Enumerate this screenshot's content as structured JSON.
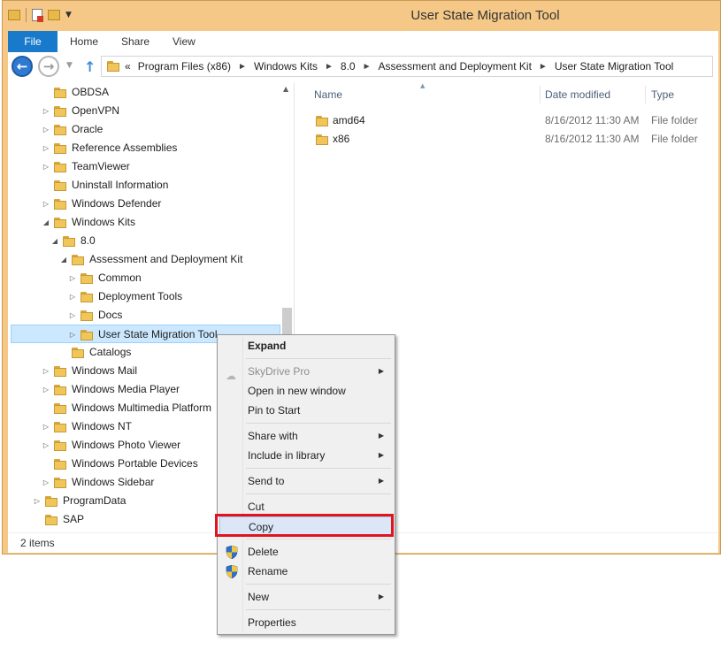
{
  "window": {
    "title": "User State Migration Tool"
  },
  "ribbon": {
    "tabs": [
      "File",
      "Home",
      "Share",
      "View"
    ]
  },
  "address": {
    "prefix": "«",
    "crumbs": [
      "Program Files (x86)",
      "Windows Kits",
      "8.0",
      "Assessment and Deployment Kit",
      "User State Migration Tool"
    ]
  },
  "nav_tree": [
    {
      "label": "OBDSA",
      "level": 2,
      "expander": ""
    },
    {
      "label": "OpenVPN",
      "level": 2,
      "expander": "▷"
    },
    {
      "label": "Oracle",
      "level": 2,
      "expander": "▷"
    },
    {
      "label": "Reference Assemblies",
      "level": 2,
      "expander": "▷"
    },
    {
      "label": "TeamViewer",
      "level": 2,
      "expander": "▷"
    },
    {
      "label": "Uninstall Information",
      "level": 2,
      "expander": ""
    },
    {
      "label": "Windows Defender",
      "level": 2,
      "expander": "▷"
    },
    {
      "label": "Windows Kits",
      "level": 2,
      "expander": "◢"
    },
    {
      "label": "8.0",
      "level": 3,
      "expander": "◢"
    },
    {
      "label": "Assessment and Deployment Kit",
      "level": 4,
      "expander": "◢"
    },
    {
      "label": "Common",
      "level": 5,
      "expander": "▷"
    },
    {
      "label": "Deployment Tools",
      "level": 5,
      "expander": "▷"
    },
    {
      "label": "Docs",
      "level": 5,
      "expander": "▷"
    },
    {
      "label": "User State Migration Tool",
      "level": 5,
      "expander": "▷",
      "selected": true
    },
    {
      "label": "Catalogs",
      "level": 4,
      "expander": ""
    },
    {
      "label": "Windows Mail",
      "level": 2,
      "expander": "▷"
    },
    {
      "label": "Windows Media Player",
      "level": 2,
      "expander": "▷"
    },
    {
      "label": "Windows Multimedia Platform",
      "level": 2,
      "expander": ""
    },
    {
      "label": "Windows NT",
      "level": 2,
      "expander": "▷"
    },
    {
      "label": "Windows Photo Viewer",
      "level": 2,
      "expander": "▷"
    },
    {
      "label": "Windows Portable Devices",
      "level": 2,
      "expander": ""
    },
    {
      "label": "Windows Sidebar",
      "level": 2,
      "expander": "▷"
    },
    {
      "label": "ProgramData",
      "level": 1,
      "expander": "▷"
    },
    {
      "label": "SAP",
      "level": 1,
      "expander": ""
    }
  ],
  "columns": {
    "name": "Name",
    "date": "Date modified",
    "type": "Type"
  },
  "files": [
    {
      "name": "amd64",
      "date": "8/16/2012 11:30 AM",
      "type": "File folder"
    },
    {
      "name": "x86",
      "date": "8/16/2012 11:30 AM",
      "type": "File folder"
    }
  ],
  "status": {
    "items": "2 items"
  },
  "context_menu": [
    {
      "label": "Expand",
      "bold": true
    },
    {
      "sep": true
    },
    {
      "label": "SkyDrive Pro",
      "submenu": true,
      "disabled": true,
      "icon": "skydrive-icon"
    },
    {
      "label": "Open in new window"
    },
    {
      "label": "Pin to Start"
    },
    {
      "sep": true
    },
    {
      "label": "Share with",
      "submenu": true
    },
    {
      "label": "Include in library",
      "submenu": true
    },
    {
      "sep": true
    },
    {
      "label": "Send to",
      "submenu": true
    },
    {
      "sep": true
    },
    {
      "label": "Cut"
    },
    {
      "label": "Copy",
      "highlighted": true
    },
    {
      "sep": true
    },
    {
      "label": "Delete",
      "icon": "uac-shield-icon"
    },
    {
      "label": "Rename",
      "icon": "uac-shield-icon"
    },
    {
      "sep": true
    },
    {
      "label": "New",
      "submenu": true
    },
    {
      "sep": true
    },
    {
      "label": "Properties"
    }
  ],
  "colors": {
    "title_bar": "#f5c887",
    "file_tab": "#1979ca",
    "selection": "#cce8ff",
    "annotation": "#e0141e"
  }
}
